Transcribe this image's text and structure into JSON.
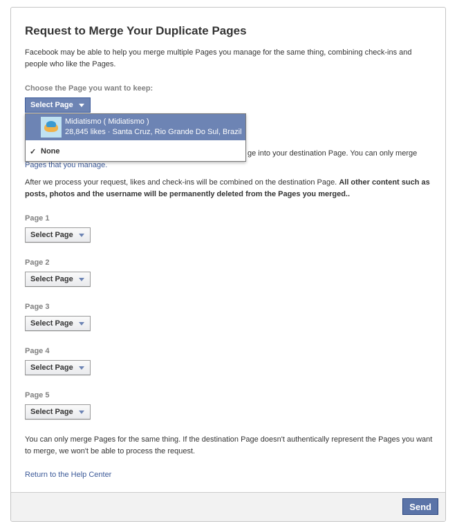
{
  "dialog": {
    "title": "Request to Merge Your Duplicate Pages",
    "intro": "Facebook may be able to help you merge multiple Pages you manage for the same thing, combining check-ins and people who like the Pages.",
    "keep_label": "Choose the Page you want to keep:",
    "keep_select": "Select Page",
    "merge_info_visible": "ge into your destination Page. You can only merge",
    "merge_info_link": "Pages that you manage.",
    "after_normal": "After we process your request, likes and check-ins will be combined on the destination Page. ",
    "after_bold": "All other content such as posts, photos and the username will be permanently deleted from the Pages you merged.",
    "after_tail": ".",
    "pages": [
      {
        "label": "Page 1",
        "select": "Select Page"
      },
      {
        "label": "Page 2",
        "select": "Select Page"
      },
      {
        "label": "Page 3",
        "select": "Select Page"
      },
      {
        "label": "Page 4",
        "select": "Select Page"
      },
      {
        "label": "Page 5",
        "select": "Select Page"
      }
    ],
    "disclaimer": "You can only merge Pages for the same thing. If the destination Page doesn't authentically represent the Pages you want to merge, we won't be able to process the request.",
    "help_link": "Return to the Help Center",
    "send_button": "Send"
  },
  "dropdown": {
    "page_name": "Midiatismo ( Midiatismo )",
    "page_meta": "28,845 likes · Santa Cruz, Rio Grande Do Sul, Brazil",
    "none_label": "None",
    "none_checked": true,
    "thumbnail_icon": "turtle-logo-icon"
  },
  "colors": {
    "accent": "#3b5998",
    "highlight": "#6d84b4",
    "send": "#5b74a8"
  }
}
